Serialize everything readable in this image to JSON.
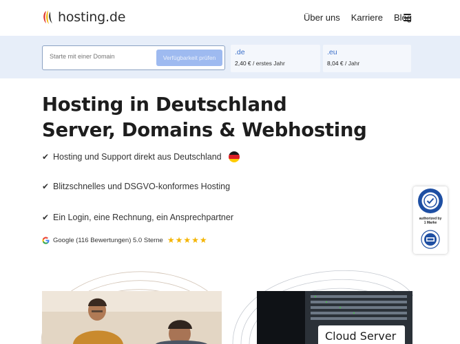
{
  "header": {
    "logo_text": "hosting.de",
    "nav": [
      "Über uns",
      "Karriere",
      "Blog"
    ]
  },
  "domain_search": {
    "placeholder": "Starte mit einer Domain",
    "button_label": "Verfügbarkeit prüfen",
    "tlds": [
      {
        "tld": ".de",
        "price": "2,40 €",
        "period": " / erstes Jahr"
      },
      {
        "tld": ".eu",
        "price": "8,04 €",
        "period": " / Jahr"
      }
    ]
  },
  "hero": {
    "title_line1": "Hosting in Deutschland",
    "title_line2": "Server, Domains & Webhosting",
    "features": [
      "Hosting und Support direkt aus Deutschland",
      "Blitzschnelles und DSGVO-konformes Hosting",
      "Ein Login, eine Rechnung, ein Ansprechpartner"
    ],
    "check_glyph": "✔",
    "rating_text": "Google (116 Bewertungen) 5.0 Sterne",
    "rating_stars": 5
  },
  "badge": {
    "lines": [
      "authorized by",
      "1 Marke"
    ]
  },
  "products": {
    "cloud_label": "Cloud Server"
  },
  "colors": {
    "accent": "#3a6fc9",
    "domainbar_bg": "#e7eef9",
    "star": "#f4b400"
  },
  "icons": [
    "logo-mark-icon",
    "menu-icon",
    "check-icon",
    "german-flag-icon",
    "google-icon",
    "star-icon",
    "tuv-badge-icon"
  ]
}
